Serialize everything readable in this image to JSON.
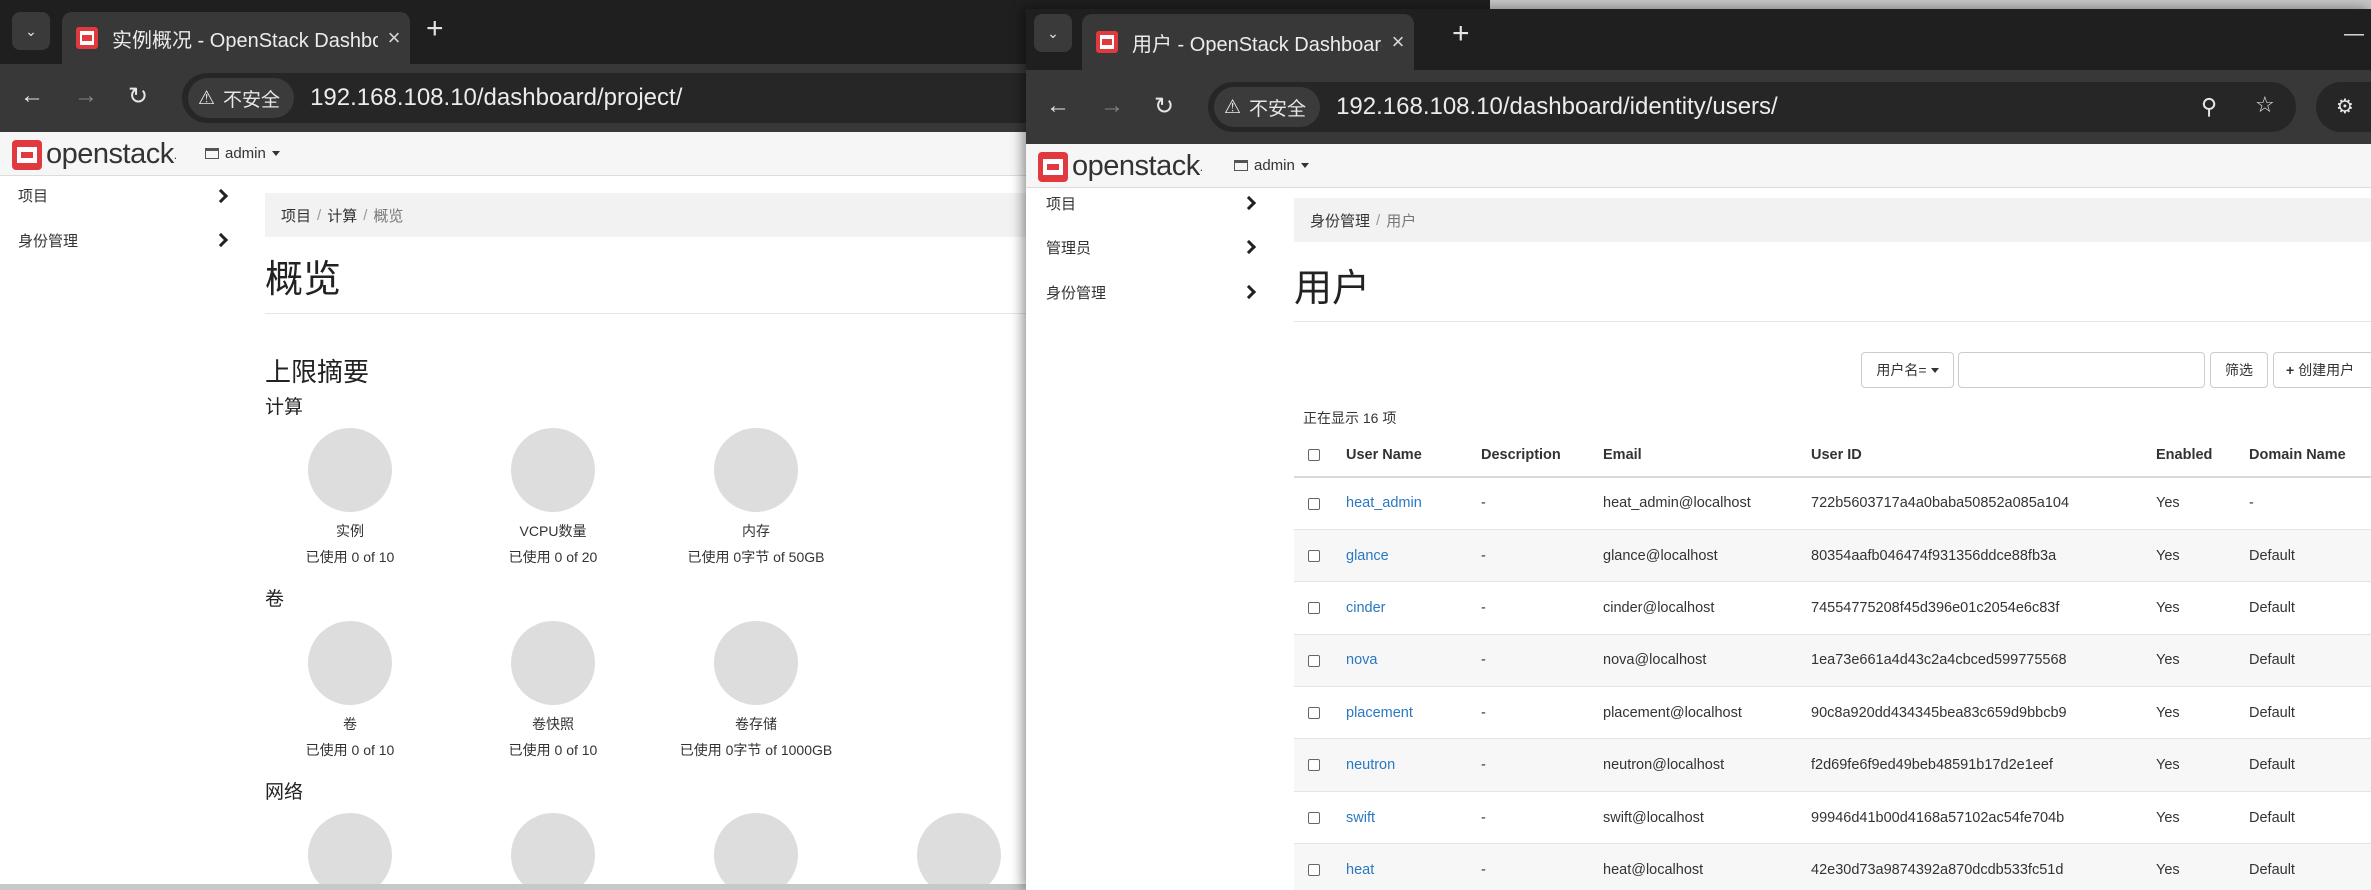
{
  "window_left": {
    "tab_title": "实例概况 - OpenStack Dashboard",
    "url": "192.168.108.10/dashboard/project/",
    "security_label": "不安全",
    "brand": "openstack",
    "project": "admin",
    "sidebar": [
      {
        "label": "项目"
      },
      {
        "label": "身份管理"
      }
    ],
    "breadcrumb": [
      "项目",
      "计算",
      "概览"
    ],
    "page_title": "概览",
    "limits_title": "上限摘要",
    "sections": [
      {
        "title": "计算",
        "items": [
          {
            "label": "实例",
            "usage": "已使用 0 of 10"
          },
          {
            "label": "VCPU数量",
            "usage": "已使用 0 of 20"
          },
          {
            "label": "内存",
            "usage": "已使用 0字节 of 50GB"
          }
        ]
      },
      {
        "title": "卷",
        "items": [
          {
            "label": "卷",
            "usage": "已使用 0 of 10"
          },
          {
            "label": "卷快照",
            "usage": "已使用 0 of 10"
          },
          {
            "label": "卷存储",
            "usage": "已使用 0字节 of 1000GB"
          }
        ]
      },
      {
        "title": "网络"
      }
    ]
  },
  "window_right": {
    "tab_title": "用户 - OpenStack Dashboard",
    "url": "192.168.108.10/dashboard/identity/users/",
    "security_label": "不安全",
    "brand": "openstack",
    "project": "admin",
    "sidebar": [
      {
        "label": "项目"
      },
      {
        "label": "管理员"
      },
      {
        "label": "身份管理"
      }
    ],
    "breadcrumb": [
      "身份管理",
      "用户"
    ],
    "page_title": "用户",
    "filter_field": "用户名=",
    "filter_button": "筛选",
    "create_button": "创建用户",
    "count_text": "正在显示 16 项",
    "columns": [
      "User Name",
      "Description",
      "Email",
      "User ID",
      "Enabled",
      "Domain Name"
    ],
    "rows": [
      {
        "name": "heat_admin",
        "description": "-",
        "email": "heat_admin@localhost",
        "id": "722b5603717a4a0baba50852a085a104",
        "enabled": "Yes",
        "domain": "-"
      },
      {
        "name": "glance",
        "description": "-",
        "email": "glance@localhost",
        "id": "80354aafb046474f931356ddce88fb3a",
        "enabled": "Yes",
        "domain": "Default"
      },
      {
        "name": "cinder",
        "description": "-",
        "email": "cinder@localhost",
        "id": "74554775208f45d396e01c2054e6c83f",
        "enabled": "Yes",
        "domain": "Default"
      },
      {
        "name": "nova",
        "description": "-",
        "email": "nova@localhost",
        "id": "1ea73e661a4d43c2a4cbced599775568",
        "enabled": "Yes",
        "domain": "Default"
      },
      {
        "name": "placement",
        "description": "-",
        "email": "placement@localhost",
        "id": "90c8a920dd434345bea83c659d9bbcb9",
        "enabled": "Yes",
        "domain": "Default"
      },
      {
        "name": "neutron",
        "description": "-",
        "email": "neutron@localhost",
        "id": "f2d69fe6f9ed49beb48591b17d2e1eef",
        "enabled": "Yes",
        "domain": "Default"
      },
      {
        "name": "swift",
        "description": "-",
        "email": "swift@localhost",
        "id": "99946d41b00d4168a57102ac54fe704b",
        "enabled": "Yes",
        "domain": "Default"
      },
      {
        "name": "heat",
        "description": "-",
        "email": "heat@localhost",
        "id": "42e30d73a9874392a870dcdb533fc51d",
        "enabled": "Yes",
        "domain": "Default"
      }
    ]
  },
  "colors": {
    "brand_red": "#e03a3e",
    "link_blue": "#2a78c2",
    "chrome_dark": "#1f1f1f"
  }
}
